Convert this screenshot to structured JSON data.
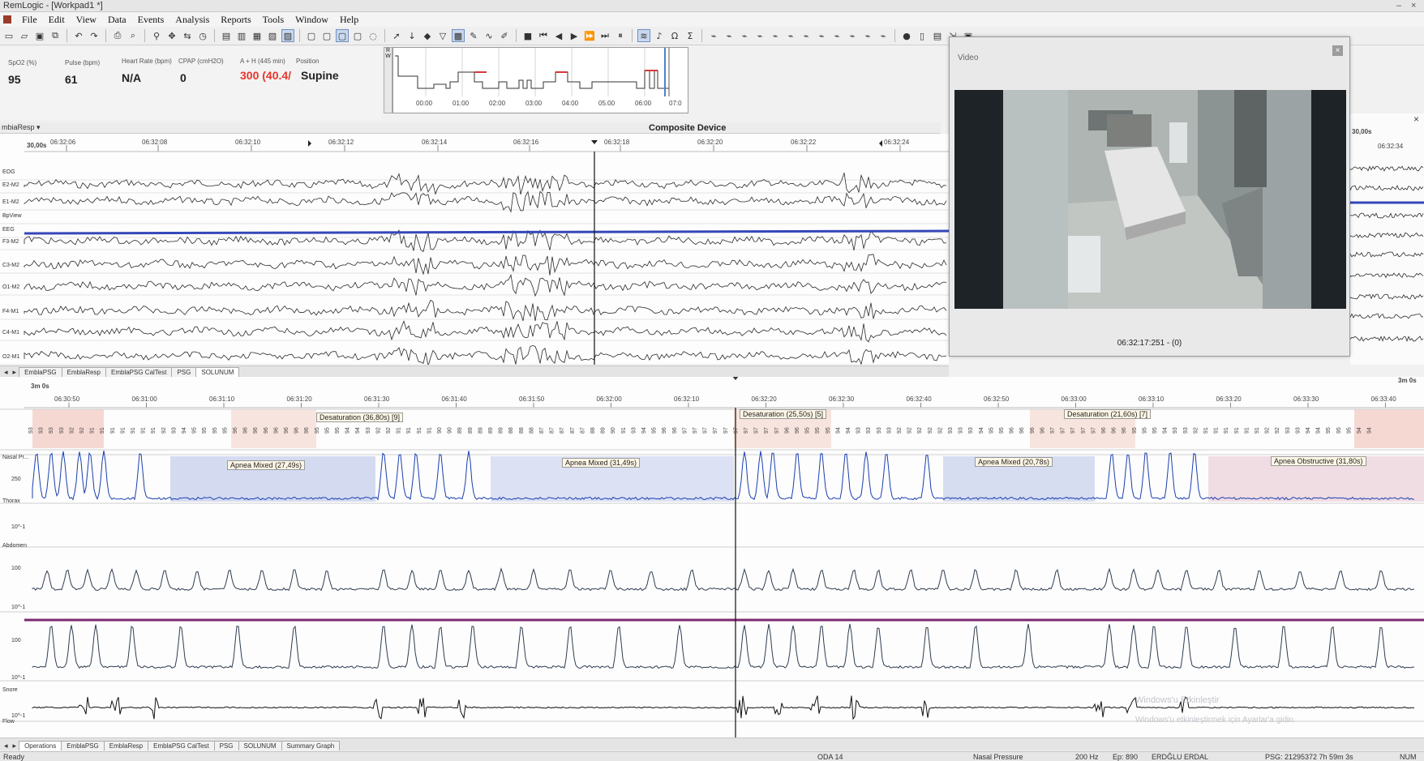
{
  "window": {
    "title": "RemLogic - [Workpad1 *]"
  },
  "menu": [
    "File",
    "Edit",
    "View",
    "Data",
    "Events",
    "Analysis",
    "Reports",
    "Tools",
    "Window",
    "Help"
  ],
  "vitals": {
    "labels": [
      "SpO2 (%)",
      "Pulse (bpm)",
      "Heart Rate (bpm)",
      "CPAP (cmH2O)",
      "A + H (445 min)",
      "Position"
    ],
    "values": {
      "spo2": "95",
      "pulse": "61",
      "heart_rate": "N/A",
      "cpap": "0",
      "ah": "300 (40.4/",
      "position": "Supine"
    }
  },
  "hypnogram": {
    "side": "R W",
    "ticks": [
      "00:00",
      "01:00",
      "02:00",
      "03:00",
      "04:00",
      "05:00",
      "06:00",
      "07:0"
    ]
  },
  "upper_view": {
    "header_title": "Composite Device",
    "montage": "mbiaResp",
    "scale": "30,00s",
    "ticks": [
      "06:32:06",
      "06:32:08",
      "06:32:10",
      "06:32:12",
      "06:32:14",
      "06:32:16",
      "06:32:18",
      "06:32:20",
      "06:32:22",
      "06:32:24"
    ],
    "right_scale": "30,00s",
    "right_tick": "06:32:34",
    "channels": [
      "EOG",
      "E2-M2",
      "E1-M2",
      "BpView",
      "EEG",
      "F3-M2",
      "C3-M2",
      "O1-M2",
      "F4-M1",
      "C4-M1",
      "O2-M1"
    ]
  },
  "upper_tabs": [
    "EmblaPSG",
    "EmblaResp",
    "EmblaPSG CalTest",
    "PSG",
    "SOLUNUM"
  ],
  "video": {
    "title": "Video",
    "timestamp": "06:32:17:251 - (0)"
  },
  "lower_view": {
    "scale": "3m 0s",
    "right_scale": "3m 0s",
    "ticks": [
      "06:30:50",
      "06:31:00",
      "06:31:10",
      "06:31:20",
      "06:31:30",
      "06:31:40",
      "06:31:50",
      "06:32:00",
      "06:32:10",
      "06:32:20",
      "06:32:30",
      "06:32:40",
      "06:32:50",
      "06:33:00",
      "06:33:10",
      "06:33:20",
      "06:33:30",
      "06:33:40"
    ],
    "desaturations": [
      "Desaturation (36,80s) [9]",
      "Desaturation (25,50s) [5]",
      "Desaturation (21,60s) [7]"
    ],
    "apneas": [
      "Apnea Mixed (27,49s)",
      "Apnea Mixed (31,49s)",
      "Apnea Mixed (20,78s)",
      "Apnea Obstructive (31,80s)"
    ],
    "channels": [
      "Nasal Pr...",
      "Thorax",
      "Abdomen",
      "Snore",
      "Flow"
    ],
    "y_labels": {
      "nasal_top": "250",
      "nasal_bot": "10^-1",
      "thorax_top": "100",
      "thorax_bot": "10^-1",
      "abd_top": "100",
      "abd_bot": "10^-1",
      "snore_bot": "10^-1"
    },
    "spo2_values": "93 93 93 93 92 92 91 91 91 91 91 91 91 92 93 94 95 95 95 95 96 96 96 96 96 96 96 96 95 95 95 94 94 93 92 92 91 91 91 91 90 90 89 89 89 89 89 88 88 88 87 87 87 87 87 88 89 90 91 93 94 95 96 96 97 97 97 97 97 97 97 97 97 97 96 96 95 95 95 94 94 93 93 93 93 92 92 92 92 92 93 93 93 94 95 95 96 96 96 96 97 97 97 97 97 96 96 96 95 95 95 94 93 93 92 91 91 91 91 91 91 92 92 93 93 94 94 95 95 95 94 94"
  },
  "lower_tabs": [
    "Operations",
    "EmblaPSG",
    "EmblaResp",
    "EmblaPSG CalTest",
    "PSG",
    "SOLUNUM",
    "Summary Graph"
  ],
  "watermark": [
    "Windows'u Etkinleştir",
    "Windows'u etkinleştirmek için Ayarlar'a gidin."
  ],
  "status": {
    "ready": "Ready",
    "room": "ODA 14",
    "channel": "Nasal Pressure",
    "rate": "200 Hz",
    "epoch": "Ep: 890",
    "patient": "ERDĞLU ERDAL",
    "psg": "PSG: 21295372 7h 59m 3s",
    "num": "NUM"
  }
}
